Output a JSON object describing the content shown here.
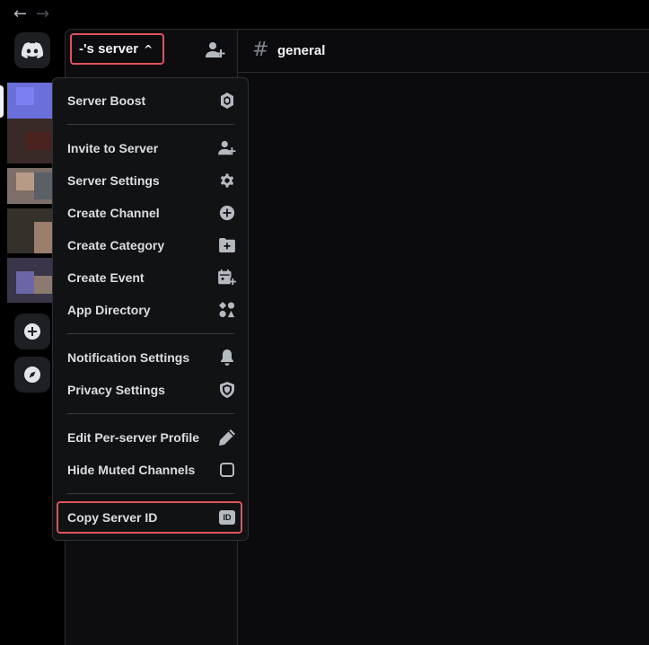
{
  "nav": {
    "back": "←",
    "forward": "→"
  },
  "server": {
    "name": "-'s server",
    "chevron": "^"
  },
  "channel": {
    "hash": "#",
    "name": "general"
  },
  "menu": {
    "items": [
      {
        "label": "Server Boost",
        "icon": "boost-icon"
      },
      {
        "label": "Invite to Server",
        "icon": "add-person-icon"
      },
      {
        "label": "Server Settings",
        "icon": "gear-icon"
      },
      {
        "label": "Create Channel",
        "icon": "plus-circle-icon"
      },
      {
        "label": "Create Category",
        "icon": "folder-plus-icon"
      },
      {
        "label": "Create Event",
        "icon": "calendar-plus-icon"
      },
      {
        "label": "App Directory",
        "icon": "apps-icon"
      },
      {
        "label": "Notification Settings",
        "icon": "bell-icon"
      },
      {
        "label": "Privacy Settings",
        "icon": "shield-icon"
      },
      {
        "label": "Edit Per-server Profile",
        "icon": "pencil-icon"
      },
      {
        "label": "Hide Muted Channels",
        "icon": "checkbox-icon"
      },
      {
        "label": "Copy Server ID",
        "icon": "id-icon"
      }
    ],
    "id_badge": "ID"
  },
  "colors": {
    "highlight": "#e0525a",
    "background": "#000000",
    "menu_bg": "#111214",
    "accent": "#5865f2"
  }
}
